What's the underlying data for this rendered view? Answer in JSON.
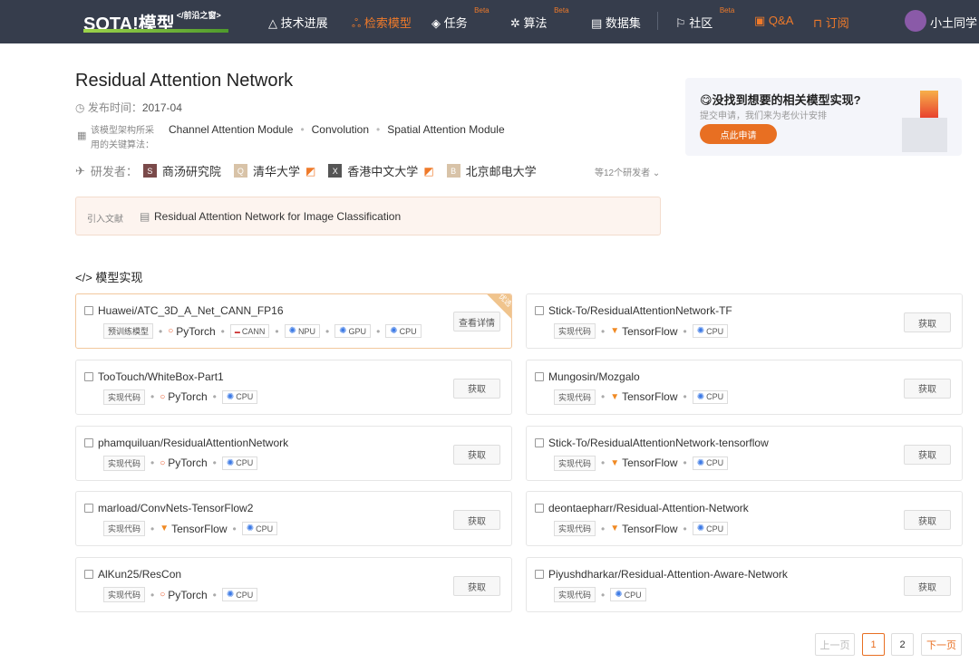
{
  "nav": {
    "logo": "SOTA!模型",
    "logo_sub": "</前沿之窗>",
    "items": [
      {
        "label": "技术进展",
        "icon": "cloud-icon"
      },
      {
        "label": "检索模型",
        "icon": "model-icon",
        "active": true
      },
      {
        "label": "任务",
        "badge": "Beta",
        "icon": "layers-icon"
      },
      {
        "label": "算法",
        "badge": "Beta",
        "icon": "atom-icon"
      },
      {
        "label": "数据集",
        "icon": "database-icon"
      },
      {
        "label": "社区",
        "badge": "Beta",
        "icon": "flag-icon"
      },
      {
        "label": "Q&A",
        "icon": "qa-icon"
      },
      {
        "label": "订阅",
        "icon": "bookmark-icon"
      }
    ],
    "user": "小土同学"
  },
  "model": {
    "title": "Residual Attention Network",
    "date_label": "发布时间：",
    "date": "2017-04",
    "algo_label_1": "该模型架构所采",
    "algo_label_2": "用的关键算法：",
    "algorithms": [
      "Channel Attention Module",
      "Convolution",
      "Spatial Attention Module"
    ],
    "dev_label": "研发者：",
    "developers": [
      {
        "initial": "S",
        "name": "商汤研究院",
        "color": "#7a4a4a"
      },
      {
        "initial": "Q",
        "name": "清华大学",
        "color": "#d8c3a8",
        "tag": true
      },
      {
        "initial": "X",
        "name": "香港中文大学",
        "color": "#555",
        "tag": true
      },
      {
        "initial": "B",
        "name": "北京邮电大学",
        "color": "#d8c3a8"
      }
    ],
    "more_devs": "等12个研发者",
    "cite_label": "引入文献",
    "cite": "Residual Attention Network for Image Classification"
  },
  "ad": {
    "title": "没找到想要的相关模型实现?",
    "sub": "提交申请，我们来为老伙计安排",
    "button": "点此申请"
  },
  "section": "模型实现",
  "impls": [
    {
      "name": "Huawei/ATC_3D_A_Net_CANN_FP16",
      "type": "预训练模型",
      "framework": "PyTorch",
      "hw": [
        "CANN",
        "NPU",
        "GPU",
        "CPU"
      ],
      "button": "查看详情",
      "badge": "优选"
    },
    {
      "name": "Stick-To/ResidualAttentionNetwork-TF",
      "type": "实现代码",
      "framework": "TensorFlow",
      "hw": [
        "CPU"
      ],
      "button": "获取"
    },
    {
      "name": "TooTouch/WhiteBox-Part1",
      "type": "实现代码",
      "framework": "PyTorch",
      "hw": [
        "CPU"
      ],
      "button": "获取"
    },
    {
      "name": "Mungosin/Mozgalo",
      "type": "实现代码",
      "framework": "TensorFlow",
      "hw": [
        "CPU"
      ],
      "button": "获取"
    },
    {
      "name": "phamquiluan/ResidualAttentionNetwork",
      "type": "实现代码",
      "framework": "PyTorch",
      "hw": [
        "CPU"
      ],
      "button": "获取"
    },
    {
      "name": "Stick-To/ResidualAttentionNetwork-tensorflow",
      "type": "实现代码",
      "framework": "TensorFlow",
      "hw": [
        "CPU"
      ],
      "button": "获取"
    },
    {
      "name": "marload/ConvNets-TensorFlow2",
      "type": "实现代码",
      "framework": "TensorFlow",
      "hw": [
        "CPU"
      ],
      "button": "获取"
    },
    {
      "name": "deontaepharr/Residual-Attention-Network",
      "type": "实现代码",
      "framework": "TensorFlow",
      "hw": [
        "CPU"
      ],
      "button": "获取"
    },
    {
      "name": "AlKun25/ResCon",
      "type": "实现代码",
      "framework": "PyTorch",
      "hw": [
        "CPU"
      ],
      "button": "获取"
    },
    {
      "name": "Piyushdharkar/Residual-Attention-Aware-Network",
      "type": "实现代码",
      "framework": "",
      "hw": [
        "CPU"
      ],
      "button": "获取"
    }
  ],
  "pagination": {
    "prev": "上一页",
    "pages": [
      "1",
      "2"
    ],
    "current": "1",
    "next": "下一页"
  }
}
